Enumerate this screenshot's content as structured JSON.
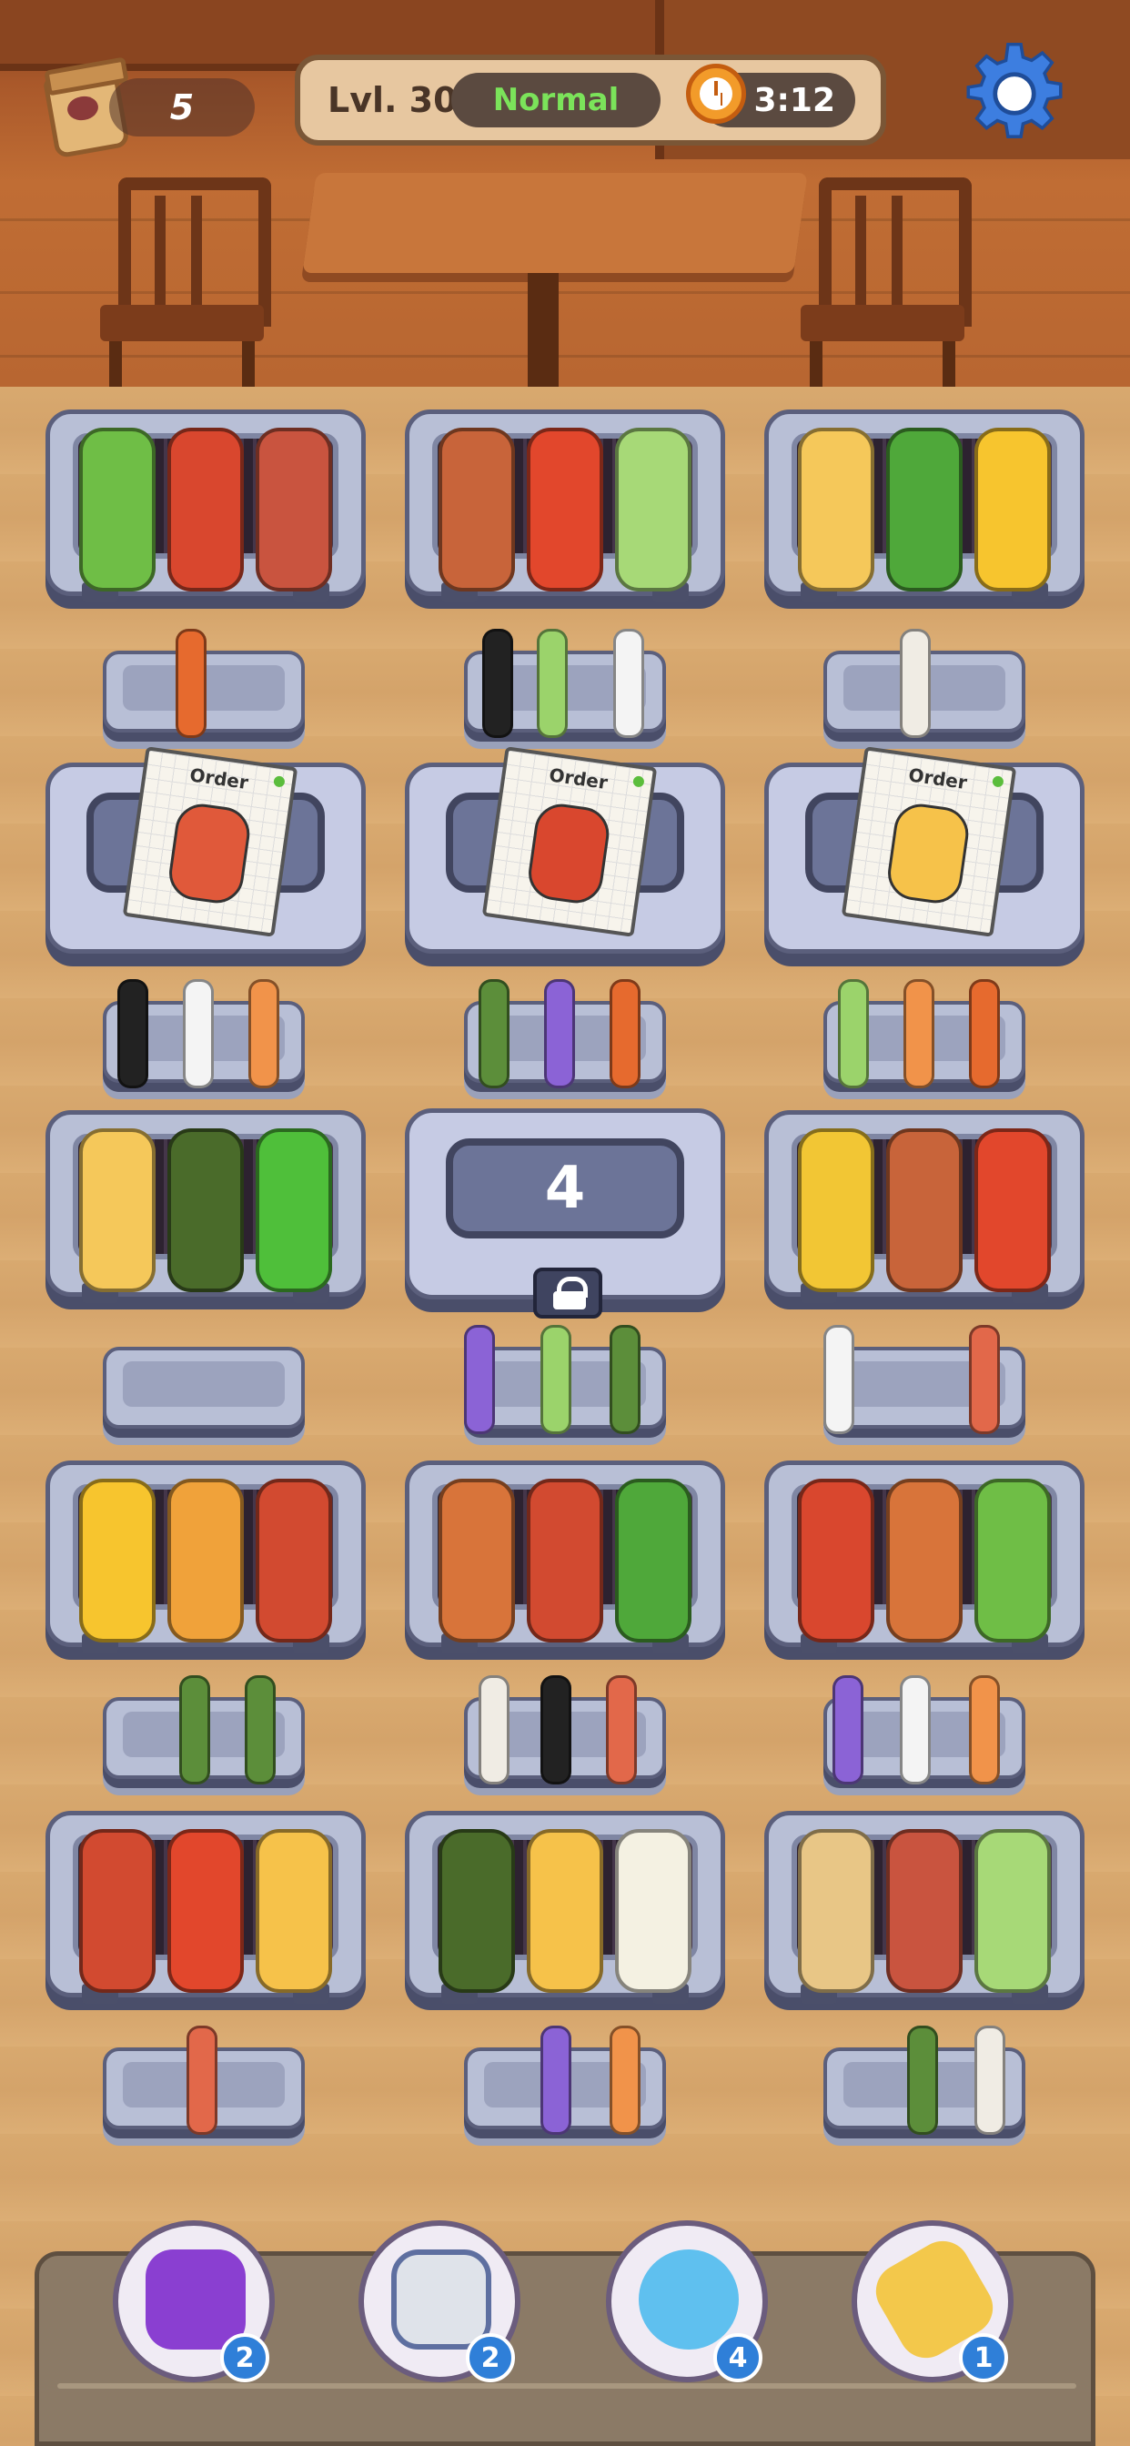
{
  "hud": {
    "bag_count": "5",
    "level": "Lvl. 30",
    "difficulty": "Normal",
    "timer": "3:12",
    "icons": {
      "bag": "paper-bag-icon",
      "clock": "alarm-clock-icon",
      "settings": "gear-icon"
    }
  },
  "colors": {
    "difficulty": "#7be35a",
    "accent_badge": "#2f7fd8"
  },
  "orders": [
    {
      "label": "Order",
      "item": "hot dog"
    },
    {
      "label": "Order",
      "item": "lobster"
    },
    {
      "label": "Order",
      "item": "cheese"
    }
  ],
  "locked_grill": {
    "count": "4"
  },
  "grill_items": [
    [
      "cabbage",
      "lobster",
      "tomahawk steak"
    ],
    [
      "bacon",
      "sausage",
      "bok choy"
    ],
    [
      "toast",
      "broccoli",
      "pineapple"
    ],
    [
      "toast",
      "mussel",
      "green pepper"
    ],
    [
      "corn",
      "bacon",
      "sausage"
    ],
    [
      "pineapple",
      "potato",
      "crab"
    ],
    [
      "drumstick",
      "crab",
      "broccoli"
    ],
    [
      "lobster",
      "drumstick",
      "cabbage"
    ],
    [
      "crab",
      "sausage",
      "tamagoyaki"
    ],
    [
      "mussel",
      "tamagoyaki",
      "cauliflower"
    ],
    [
      "tofu",
      "tomahawk steak",
      "bok choy"
    ]
  ],
  "tray_items": [
    [
      "sausage"
    ],
    [
      "sushi roll",
      "cucumber",
      "marshmallow"
    ],
    [
      "rice ball"
    ],
    [
      "sushi roll",
      "marshmallow",
      "squid"
    ],
    [
      "asparagus",
      "rainbow skewer",
      "sausage"
    ],
    [
      "cucumber",
      "squid",
      "sausage"
    ],
    [],
    [
      "rainbow skewer",
      "cucumber",
      "asparagus"
    ],
    [
      "marshmallow",
      "shrimp"
    ],
    [
      "asparagus",
      "asparagus"
    ],
    [
      "rice ball",
      "sushi roll",
      "shrimp"
    ],
    [
      "rainbow skewer",
      "marshmallow",
      "squid"
    ],
    [
      "shrimp"
    ],
    [
      "rainbow skewer",
      "squid"
    ],
    [
      "asparagus",
      "rice ball"
    ]
  ],
  "powerups": [
    {
      "name": "oven-mitt",
      "count": "2"
    },
    {
      "name": "whisk",
      "count": "2"
    },
    {
      "name": "freeze-clock",
      "count": "4"
    },
    {
      "name": "spatula",
      "count": "1"
    }
  ]
}
